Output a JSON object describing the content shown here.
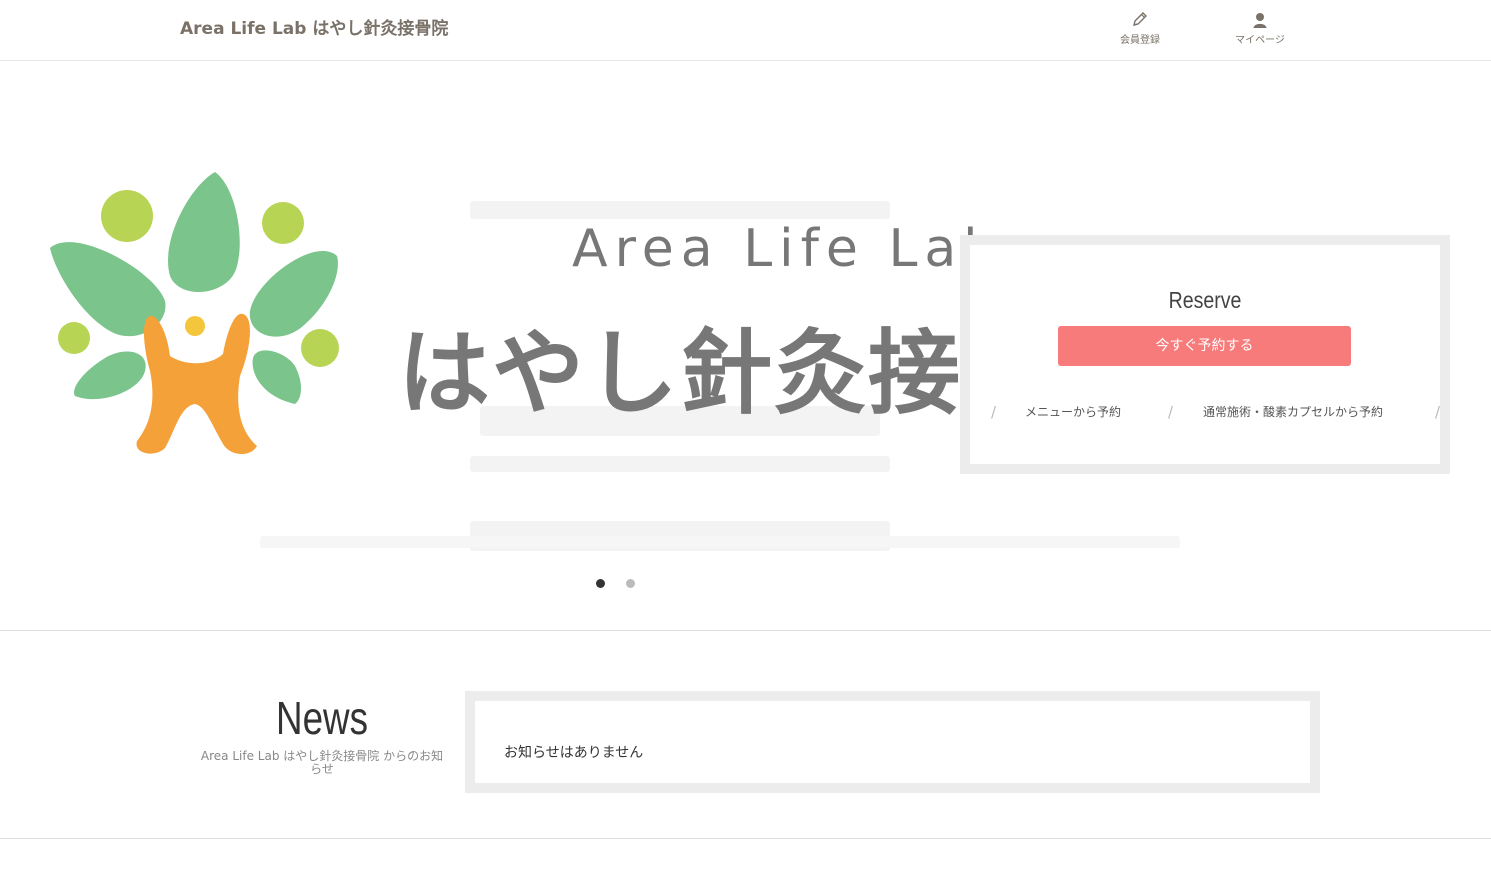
{
  "header": {
    "site_title": "Area Life Lab はやし針灸接骨院",
    "nav": [
      {
        "label": "会員登録",
        "icon": "pencil-icon"
      },
      {
        "label": "マイページ",
        "icon": "user-icon"
      }
    ]
  },
  "hero": {
    "logo_text_en": "Area Life Lab",
    "logo_text_jp": "はやし針灸接骨院",
    "slide_count": 2,
    "active_slide": 1
  },
  "reserve": {
    "title": "Reserve",
    "button_label": "今すぐ予約する",
    "links": [
      "メニューから予約",
      "通常施術・酸素カプセルから予約"
    ]
  },
  "news": {
    "title": "News",
    "subtitle": "Area Life Lab はやし針灸接骨院 からのお知らせ",
    "empty_message": "お知らせはありません"
  },
  "colors": {
    "brand_text": "#7a7268",
    "reserve_button": "#f87b7b",
    "panel_border": "#ececec"
  }
}
